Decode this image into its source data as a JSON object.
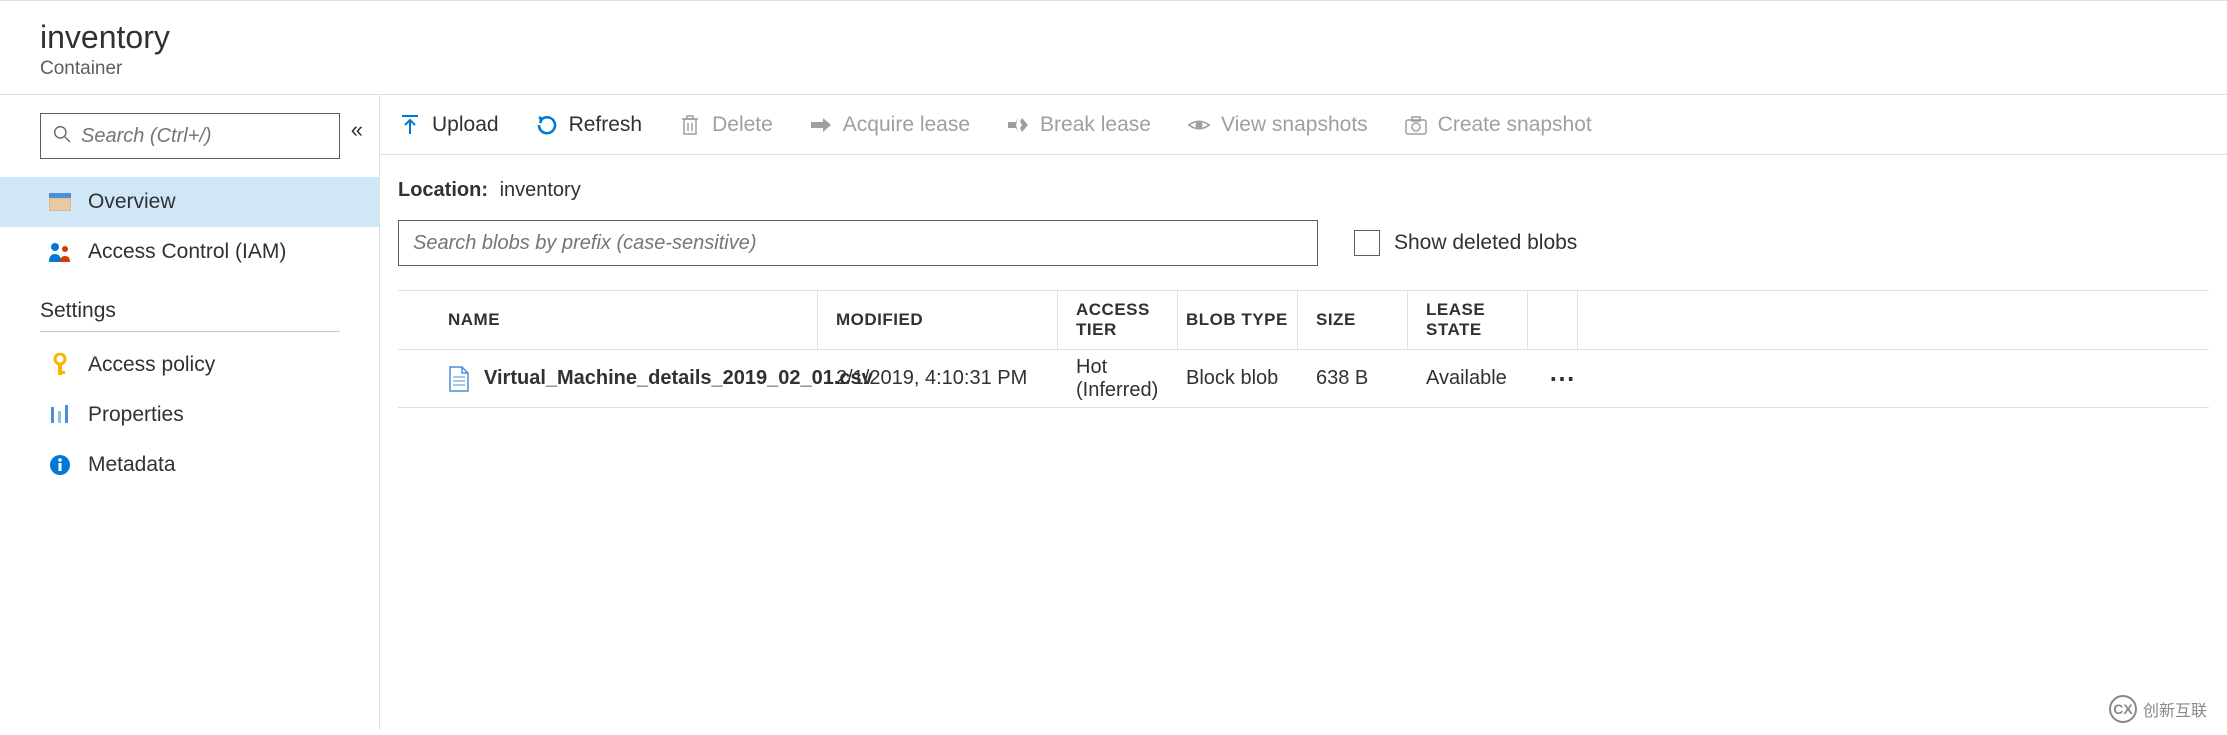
{
  "header": {
    "title": "inventory",
    "subtitle": "Container"
  },
  "sidebar": {
    "search_placeholder": "Search (Ctrl+/)",
    "items": [
      {
        "label": "Overview",
        "icon": "overview"
      },
      {
        "label": "Access Control (IAM)",
        "icon": "iam"
      }
    ],
    "section_label": "Settings",
    "settings_items": [
      {
        "label": "Access policy",
        "icon": "key"
      },
      {
        "label": "Properties",
        "icon": "props"
      },
      {
        "label": "Metadata",
        "icon": "info"
      }
    ]
  },
  "toolbar": {
    "upload": "Upload",
    "refresh": "Refresh",
    "delete": "Delete",
    "acquire": "Acquire lease",
    "break": "Break lease",
    "view_snapshots": "View snapshots",
    "create_snapshot": "Create snapshot"
  },
  "location": {
    "label": "Location:",
    "value": "inventory"
  },
  "filter": {
    "placeholder": "Search blobs by prefix (case-sensitive)",
    "show_deleted_label": "Show deleted blobs"
  },
  "table": {
    "headers": {
      "name": "NAME",
      "modified": "MODIFIED",
      "tier": "ACCESS TIER",
      "btype": "BLOB TYPE",
      "size": "SIZE",
      "lease": "LEASE STATE"
    },
    "rows": [
      {
        "name": "Virtual_Machine_details_2019_02_01.csv",
        "modified": "2/1/2019, 4:10:31 PM",
        "tier": "Hot (Inferred)",
        "btype": "Block blob",
        "size": "638 B",
        "lease": "Available"
      }
    ]
  },
  "watermark": "创新互联"
}
